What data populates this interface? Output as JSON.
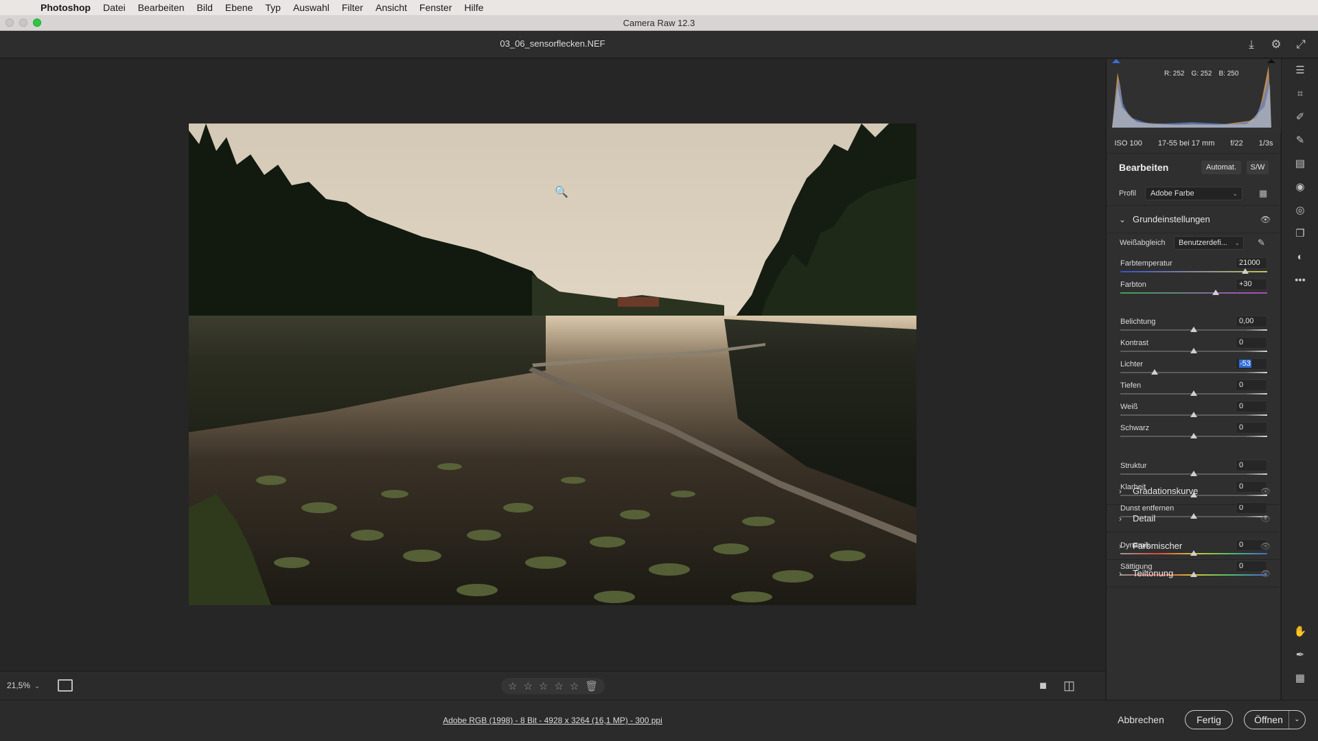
{
  "menubar": {
    "app": "Photoshop",
    "items": [
      "Datei",
      "Bearbeiten",
      "Bild",
      "Ebene",
      "Typ",
      "Auswahl",
      "Filter",
      "Ansicht",
      "Fenster",
      "Hilfe"
    ]
  },
  "window": {
    "title": "Camera Raw 12.3"
  },
  "header": {
    "filename": "03_06_sensorflecken.NEF"
  },
  "canvas_toolbar": {
    "zoom": "21,5%"
  },
  "footer": {
    "workflow_info": "Adobe RGB (1998) - 8 Bit - 4928 x 3264 (16,1 MP) - 300 ppi",
    "cancel": "Abbrechen",
    "done": "Fertig",
    "open": "Öffnen"
  },
  "histogram": {
    "r": "R: 252",
    "g": "G: 252",
    "b": "B: 250"
  },
  "exif": {
    "iso": "ISO 100",
    "lens": "17-55 bei 17 mm",
    "aperture": "f/22",
    "shutter": "1/3s"
  },
  "edit": {
    "title": "Bearbeiten",
    "auto_label": "Automat.",
    "bw_label": "S/W",
    "profile_label": "Profil",
    "profile_value": "Adobe Farbe"
  },
  "basic": {
    "title": "Grundeinstellungen",
    "wb_label": "Weißabgleich",
    "wb_value": "Benutzerdefi...",
    "sliders": [
      {
        "label": "Farbtemperatur",
        "value": "21000",
        "pos": 0.85
      },
      {
        "label": "Farbton",
        "value": "+30",
        "pos": 0.65
      },
      {
        "label": "Belichtung",
        "value": "0,00",
        "pos": 0.5
      },
      {
        "label": "Kontrast",
        "value": "0",
        "pos": 0.5
      },
      {
        "label": "Lichter",
        "value": "-53",
        "pos": 0.235
      },
      {
        "label": "Tiefen",
        "value": "0",
        "pos": 0.5
      },
      {
        "label": "Weiß",
        "value": "0",
        "pos": 0.5
      },
      {
        "label": "Schwarz",
        "value": "0",
        "pos": 0.5
      },
      {
        "label": "Struktur",
        "value": "0",
        "pos": 0.5
      },
      {
        "label": "Klarheit",
        "value": "0",
        "pos": 0.5
      },
      {
        "label": "Dunst entfernen",
        "value": "0",
        "pos": 0.5
      },
      {
        "label": "Dynamik",
        "value": "0",
        "pos": 0.5
      },
      {
        "label": "Sättigung",
        "value": "0",
        "pos": 0.5
      }
    ]
  },
  "sections": [
    "Gradationskurve",
    "Detail",
    "Farbmischer",
    "Teiltonung"
  ]
}
